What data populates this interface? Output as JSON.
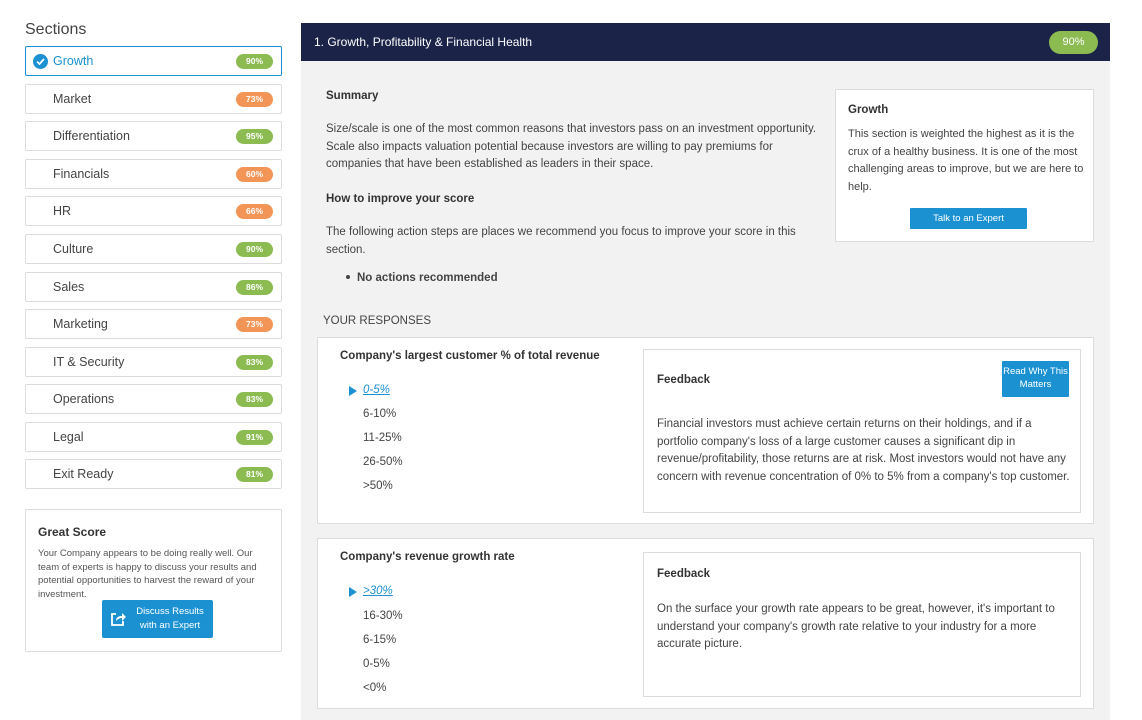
{
  "sidebar": {
    "title": "Sections",
    "items": [
      {
        "label": "Growth",
        "score": "90%",
        "color": "#8cbb52"
      },
      {
        "label": "Market",
        "score": "73%",
        "color": "#f29556"
      },
      {
        "label": "Differentiation",
        "score": "95%",
        "color": "#8cbb52"
      },
      {
        "label": "Financials",
        "score": "60%",
        "color": "#f29556"
      },
      {
        "label": "HR",
        "score": "66%",
        "color": "#f29556"
      },
      {
        "label": "Culture",
        "score": "90%",
        "color": "#8cbb52"
      },
      {
        "label": "Sales",
        "score": "86%",
        "color": "#8cbb52"
      },
      {
        "label": "Marketing",
        "score": "73%",
        "color": "#f29556"
      },
      {
        "label": "IT & Security",
        "score": "83%",
        "color": "#8cbb52"
      },
      {
        "label": "Operations",
        "score": "83%",
        "color": "#8cbb52"
      },
      {
        "label": "Legal",
        "score": "91%",
        "color": "#8cbb52"
      },
      {
        "label": "Exit Ready",
        "score": "81%",
        "color": "#8cbb52"
      }
    ],
    "great_score": {
      "title": "Great Score",
      "text": "Your Company appears to be doing really well. Our team of experts is happy to discuss your results and potential opportunities to harvest the reward of your investment.",
      "button_label": "Discuss Results with an Expert"
    }
  },
  "main": {
    "header": {
      "title": "1. Growth, Profitability & Financial Health",
      "score": "90%"
    },
    "summary_title": "Summary",
    "summary_text": "Size/scale is one of the most common reasons that investors pass on an investment opportunity. Scale also impacts valuation potential because investors are willing to pay premiums for companies that have been established as leaders in their space.",
    "improve_title": "How to improve your score",
    "improve_text": "The following action steps are places we recommend you focus to improve your score in this section.",
    "no_actions": "No actions recommended",
    "growth_card": {
      "title": "Growth",
      "text": "This section is weighted the highest as it is the crux of a healthy business. It is one of the most challenging areas to improve, but we are here to help.",
      "button_label": "Talk to an Expert"
    },
    "responses_title": "YOUR RESPONSES",
    "questions": [
      {
        "title": "Company's largest customer % of total revenue",
        "options": [
          "0-5%",
          "6-10%",
          "11-25%",
          "26-50%",
          ">50%"
        ],
        "selected": "0-5%",
        "feedback_title": "Feedback",
        "feedback_button": "Read Why This Matters",
        "feedback_text": "Financial investors must achieve certain returns on their holdings, and if a portfolio company's loss of a large customer causes a significant dip in revenue/profitability, those returns are at risk. Most investors would not have any concern with revenue concentration of 0% to 5% from a company's top customer."
      },
      {
        "title": "Company's revenue growth rate",
        "options": [
          ">30%",
          "16-30%",
          "6-15%",
          "0-5%",
          "<0%"
        ],
        "selected": ">30%",
        "feedback_title": "Feedback",
        "feedback_text": "On the surface your growth rate appears to be great, however, it's important to understand your company's growth rate relative to your industry for a more accurate picture."
      }
    ]
  },
  "colors": {
    "accent": "#1b91d2",
    "header_bg": "#1b2448",
    "green": "#8cbb52",
    "orange": "#f29556"
  }
}
